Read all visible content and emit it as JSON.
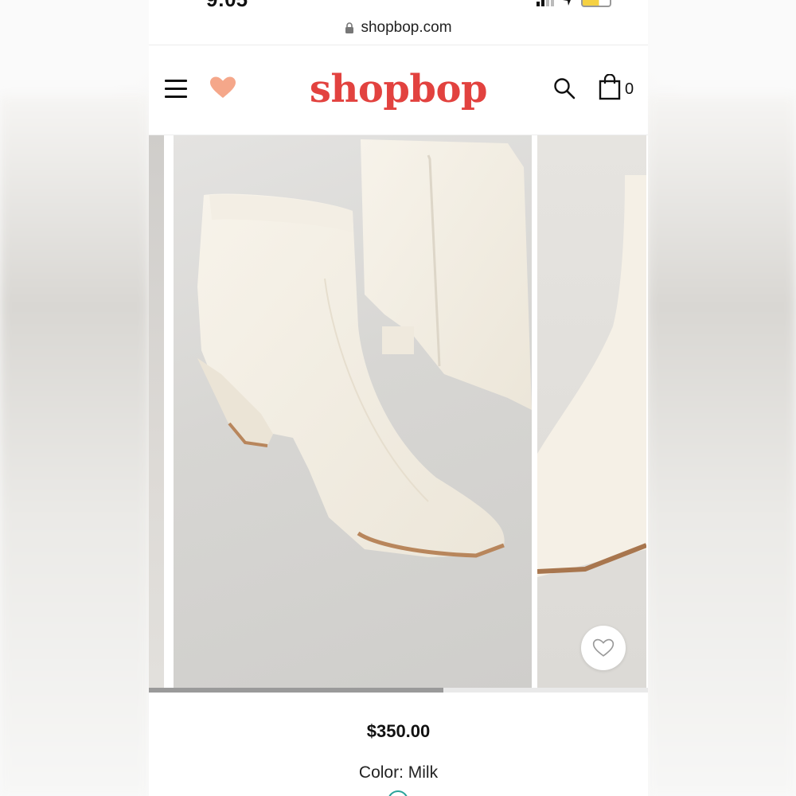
{
  "status_bar": {
    "time": "9:05"
  },
  "browser": {
    "url": "shopbop.com"
  },
  "header": {
    "logo": "shopbop",
    "cart_count": "0",
    "accent_color": "#e2423f",
    "heart_color": "#f5a78a"
  },
  "gallery": {
    "images": [
      {
        "icon": "boot-photo",
        "alt": "previous-image"
      },
      {
        "icon": "boot-photo",
        "alt": "white ankle boots"
      },
      {
        "icon": "boot-photo",
        "alt": "next-image"
      }
    ],
    "scroll_progress": 0.59
  },
  "product": {
    "price": "$350.00",
    "color_label": "Color:",
    "color_value": "Milk"
  }
}
